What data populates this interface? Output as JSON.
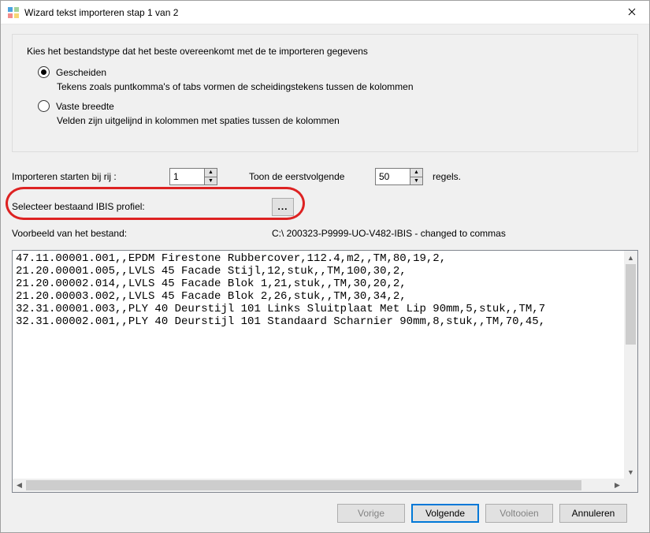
{
  "window": {
    "title": "Wizard tekst importeren stap 1 van 2"
  },
  "filetype": {
    "prompt": "Kies het bestandstype dat het beste overeenkomt met de te importeren gegevens",
    "opt1_label": "Gescheiden",
    "opt1_desc": "Tekens zoals puntkomma's of tabs vormen de scheidingstekens tussen de kolommen",
    "opt2_label": "Vaste breedte",
    "opt2_desc": "Velden zijn uitgelijnd in kolommen met spaties tussen de kolommen"
  },
  "startrow": {
    "label": "Importeren starten bij rij :",
    "value": "1"
  },
  "showrows": {
    "label": "Toon de eerstvolgende",
    "value": "50",
    "suffix": "regels."
  },
  "profile": {
    "label": "Selecteer bestaand IBIS profiel:",
    "browse": "..."
  },
  "preview": {
    "label": "Voorbeeld van het bestand:",
    "path": "C:\\ 200323-P9999-UO-V482-IBIS - changed to commas",
    "text": "47.11.00001.001,,EPDM Firestone Rubbercover,112.4,m2,,TM,80,19,2,\n21.20.00001.005,,LVLS 45 Facade Stijl,12,stuk,,TM,100,30,2,\n21.20.00002.014,,LVLS 45 Facade Blok 1,21,stuk,,TM,30,20,2,\n21.20.00003.002,,LVLS 45 Facade Blok 2,26,stuk,,TM,30,34,2,\n32.31.00001.003,,PLY 40 Deurstijl 101 Links Sluitplaat Met Lip 90mm,5,stuk,,TM,7\n32.31.00002.001,,PLY 40 Deurstijl 101 Standaard Scharnier 90mm,8,stuk,,TM,70,45,"
  },
  "buttons": {
    "prev": "Vorige",
    "next": "Volgende",
    "finish": "Voltooien",
    "cancel": "Annuleren"
  }
}
